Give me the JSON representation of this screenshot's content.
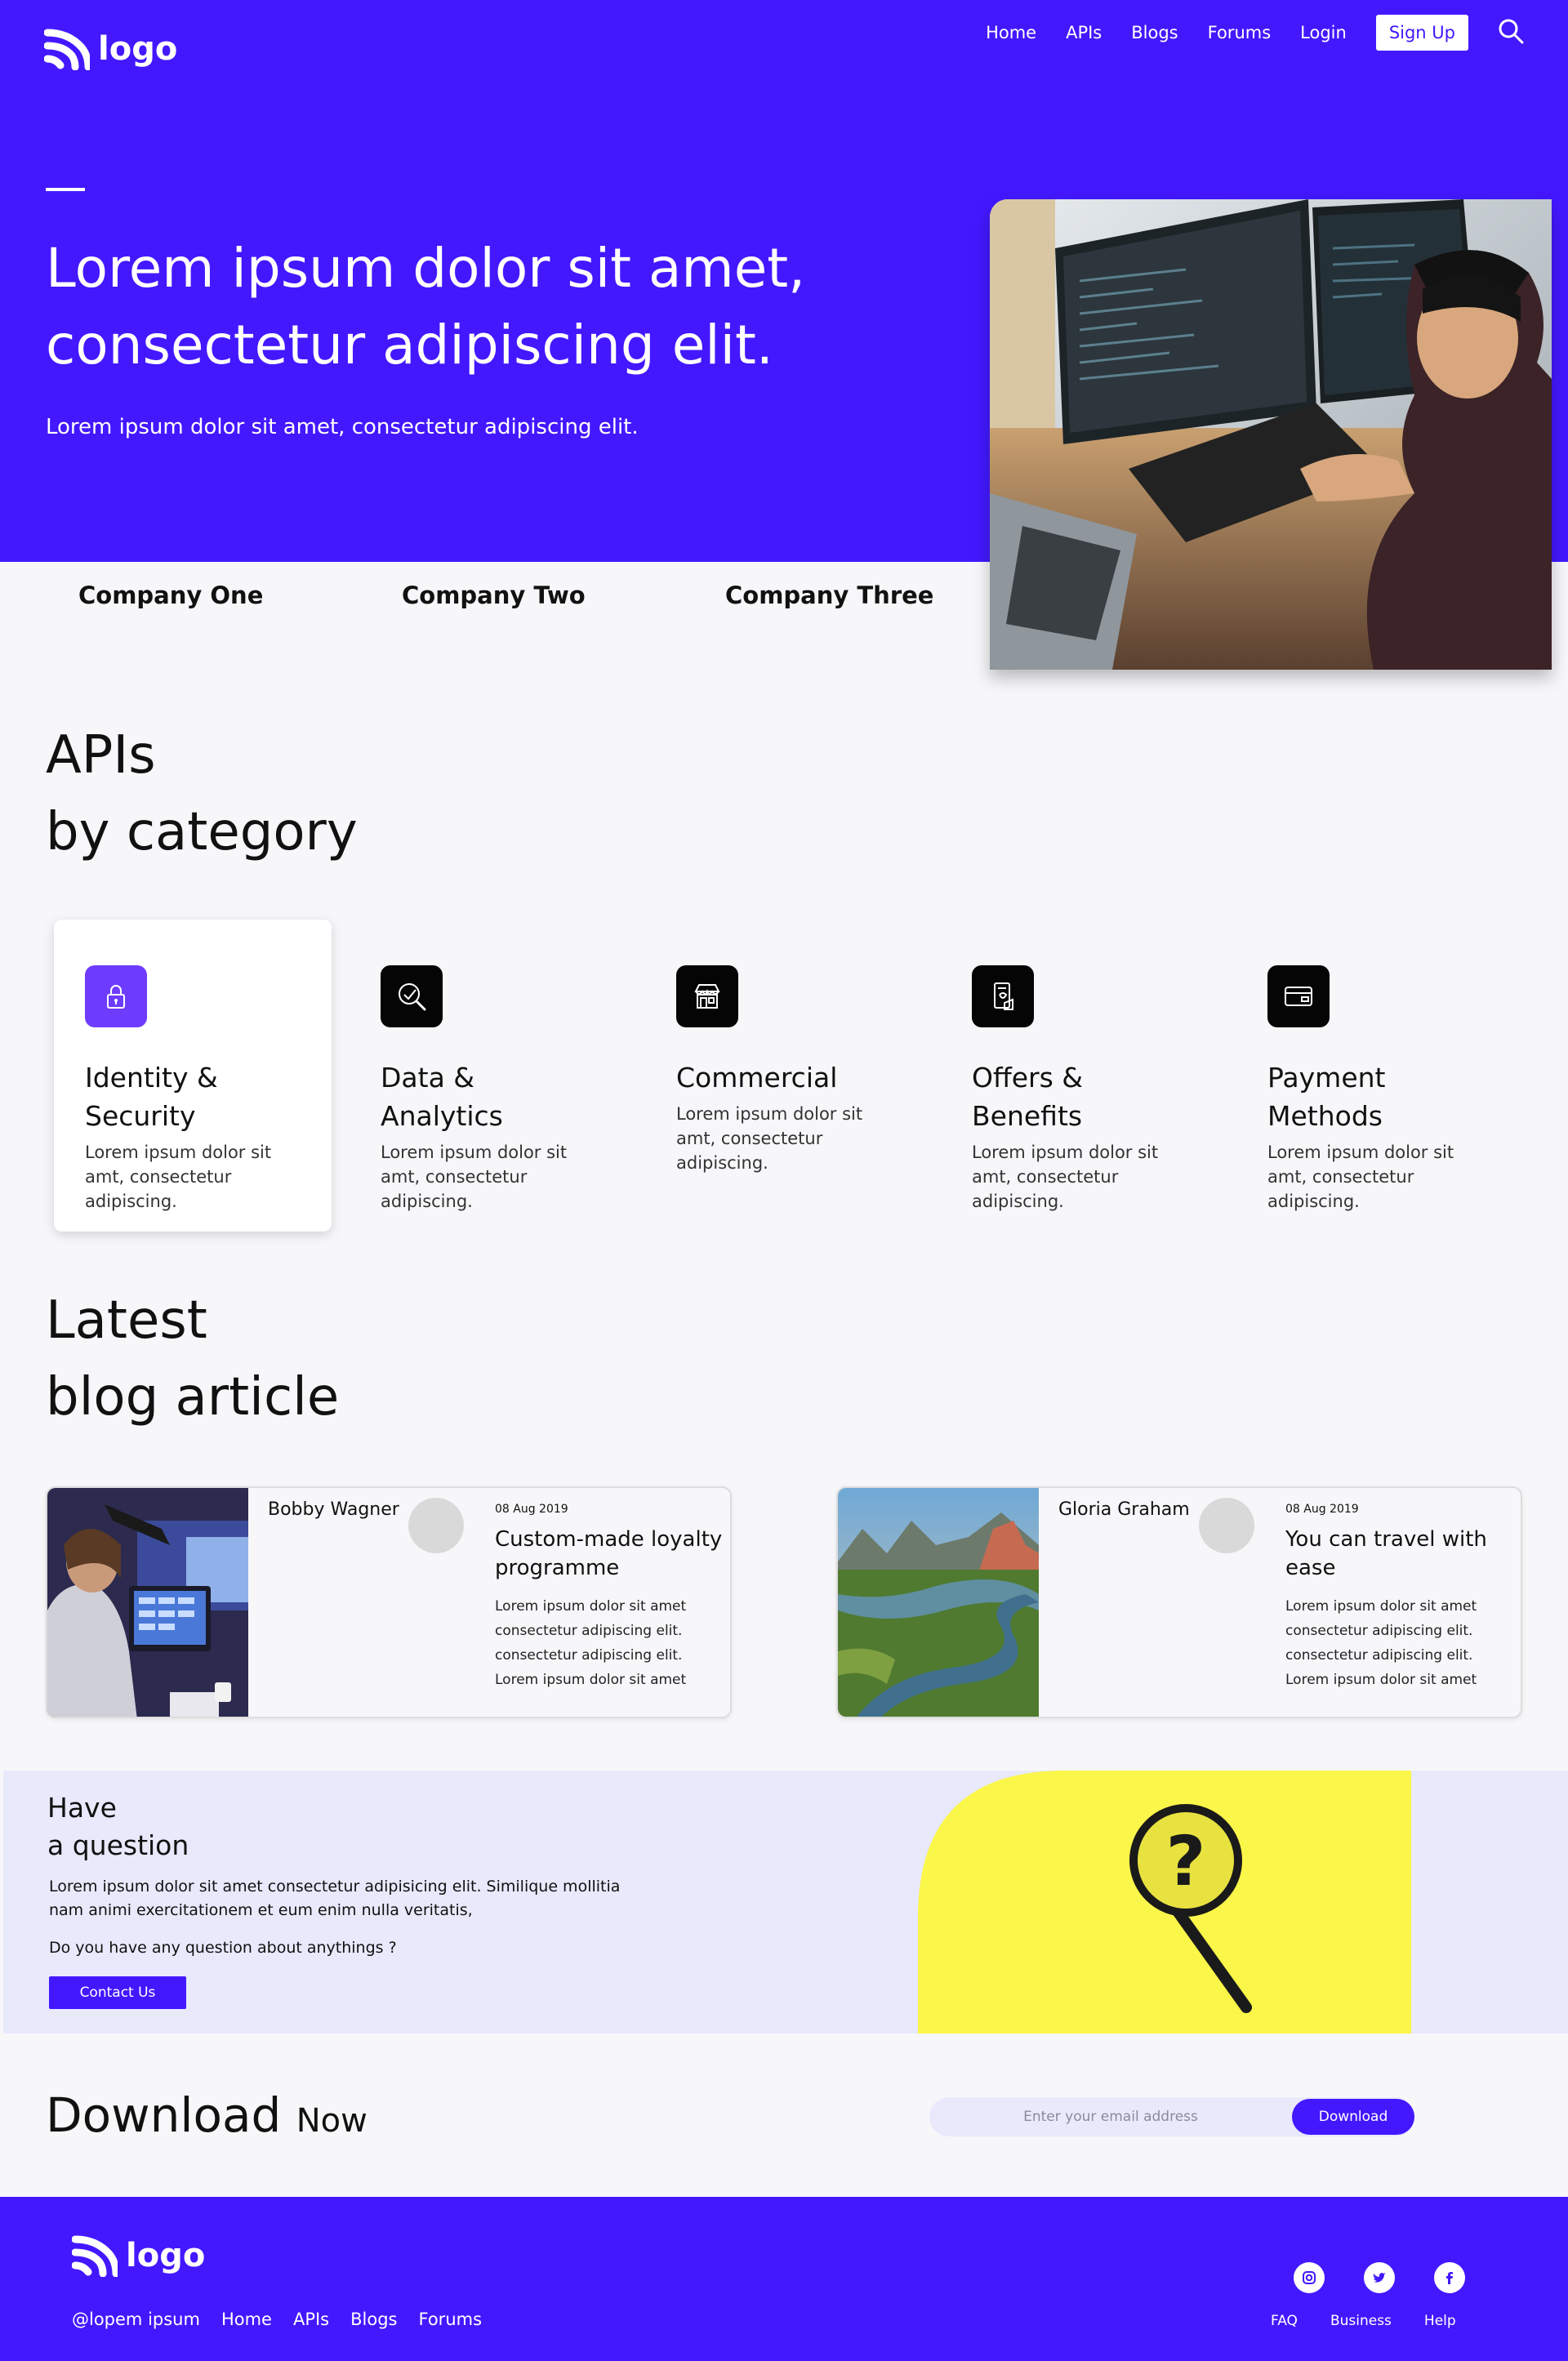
{
  "header": {
    "logo_text": "logo",
    "nav": [
      "Home",
      "APIs",
      "Blogs",
      "Forums",
      "Login"
    ],
    "signup_label": "Sign Up"
  },
  "hero": {
    "title": "Lorem ipsum dolor sit amet, consectetur adipiscing elit.",
    "subtitle": "Lorem ipsum dolor sit amet, consectetur adipiscing elit."
  },
  "companies": [
    "Company One",
    "Company Two",
    "Company Three"
  ],
  "apis": {
    "title_line1": "APIs",
    "title_line2": "by category",
    "categories": [
      {
        "title": "Identity & Security",
        "desc": "Lorem ipsum dolor sit amt, consectetur adipiscing.",
        "icon": "lock-icon",
        "active": true
      },
      {
        "title": "Data & Analytics",
        "desc": "Lorem ipsum dolor sit amt, consectetur adipiscing.",
        "icon": "analytics-icon",
        "active": false
      },
      {
        "title": "Commercial",
        "desc": "Lorem ipsum dolor sit amt, consectetur adipiscing.",
        "icon": "store-icon",
        "active": false
      },
      {
        "title": "Offers & Benefits",
        "desc": "Lorem ipsum dolor sit amt, consectetur adipiscing.",
        "icon": "offers-icon",
        "active": false
      },
      {
        "title": "Payment Methods",
        "desc": "Lorem ipsum dolor sit amt, consectetur adipiscing.",
        "icon": "card-icon",
        "active": false
      }
    ]
  },
  "blog": {
    "title_line1": "Latest",
    "title_line2": "blog article",
    "articles": [
      {
        "author": "Bobby Wagner",
        "date": "08 Aug 2019",
        "title": "Custom-made loyalty programme",
        "text": "Lorem ipsum dolor sit amet consectetur adipiscing elit. consectetur adipiscing elit. Lorem ipsum dolor sit amet"
      },
      {
        "author": "Gloria Graham",
        "date": "08 Aug 2019",
        "title": "You can travel with ease",
        "text": "Lorem ipsum dolor sit amet consectetur adipiscing elit. consectetur adipiscing elit. Lorem ipsum dolor sit amet"
      }
    ]
  },
  "question": {
    "title_line1": "Have",
    "title_line2": "a question",
    "text": "Lorem ipsum dolor sit amet consectetur adipisicing elit. Similique mollitia nam animi exercitationem et eum enim nulla veritatis,",
    "ask": "Do you have any question about anythings ?",
    "button": "Contact Us"
  },
  "download": {
    "title": "Download",
    "title_small": "Now",
    "placeholder": "Enter your email address",
    "button": "Download"
  },
  "footer": {
    "logo_text": "logo",
    "links": [
      "@lopem ipsum",
      "Home",
      "APIs",
      "Blogs",
      "Forums"
    ],
    "help": [
      "FAQ",
      "Business",
      "Help"
    ],
    "social": [
      "instagram-icon",
      "twitter-icon",
      "facebook-icon"
    ]
  },
  "colors": {
    "brand": "#4318ff",
    "accent_light": "#e8e9fb"
  }
}
